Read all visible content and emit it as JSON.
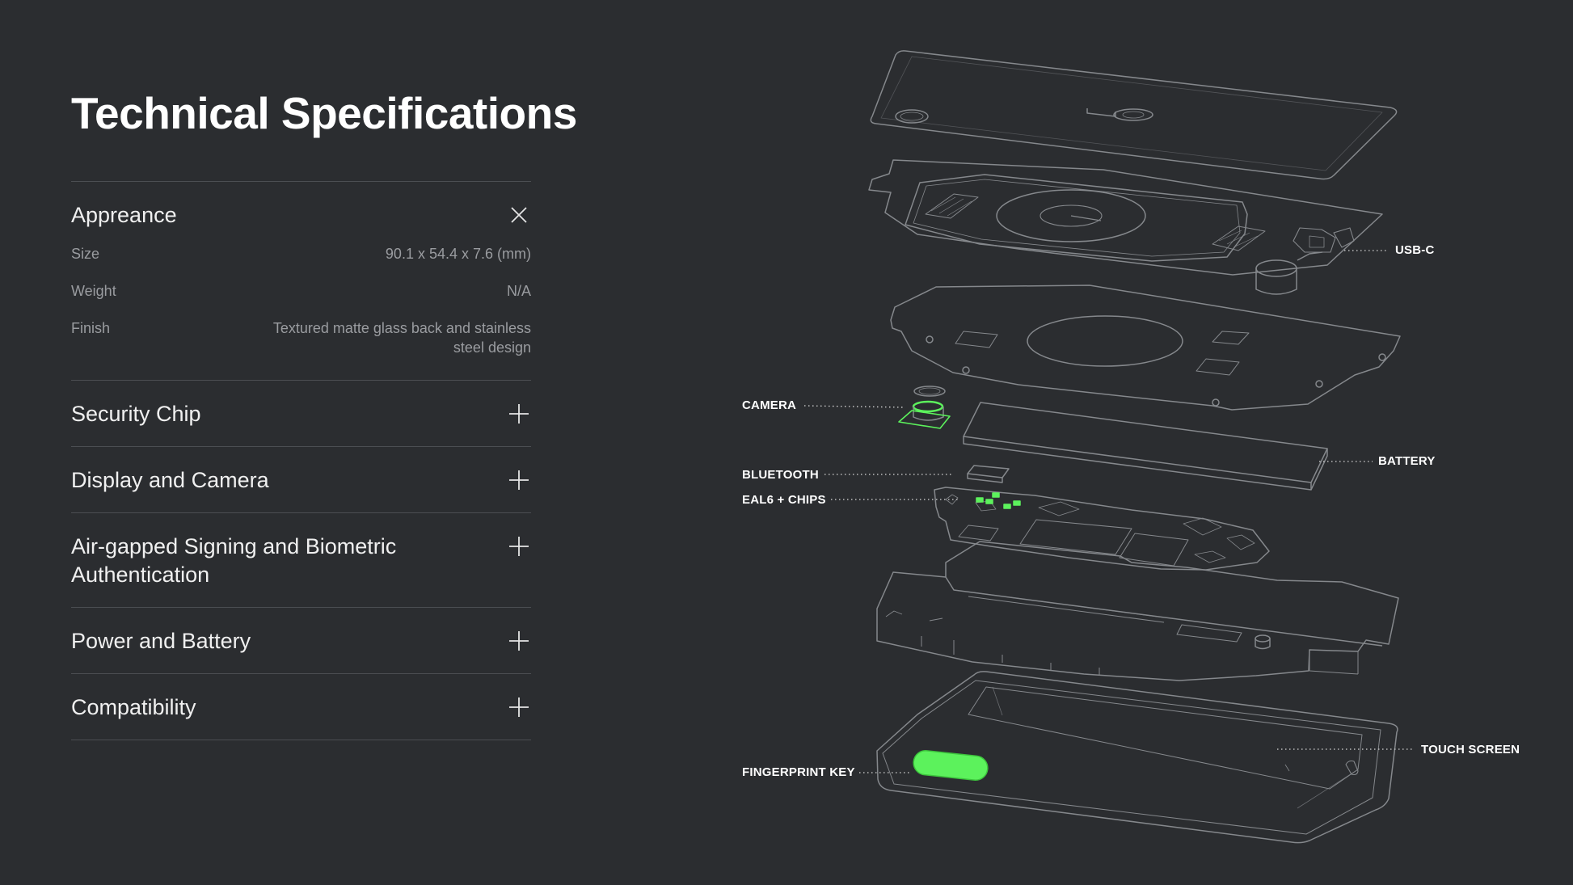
{
  "page": {
    "title": "Technical Specifications"
  },
  "accordion": {
    "open": {
      "title": "Appreance",
      "specs": [
        {
          "label": "Size",
          "value": "90.1 x 54.4 x 7.6 (mm)"
        },
        {
          "label": "Weight",
          "value": "N/A"
        },
        {
          "label": "Finish",
          "value": "Textured matte glass back and stainless steel design"
        }
      ]
    },
    "items": [
      {
        "title": "Security Chip"
      },
      {
        "title": "Display and Camera"
      },
      {
        "title": "Air-gapped Signing and Biometric Authentication"
      },
      {
        "title": "Power and Battery"
      },
      {
        "title": "Compatibility"
      }
    ]
  },
  "diagram": {
    "callouts": {
      "usbc": "USB-C",
      "camera": "CAMERA",
      "battery": "BATTERY",
      "bluetooth": "BLUETOOTH",
      "chips": "EAL6 + CHIPS",
      "touch": "TOUCH SCREEN",
      "fingerprint": "FINGERPRINT KEY"
    }
  },
  "colors": {
    "background": "#2b2d30",
    "line": "#8a8d91",
    "accent": "#5cf25c",
    "divider": "#4b4e52"
  },
  "icons": {
    "open": "close-icon",
    "closed": "plus-icon"
  }
}
